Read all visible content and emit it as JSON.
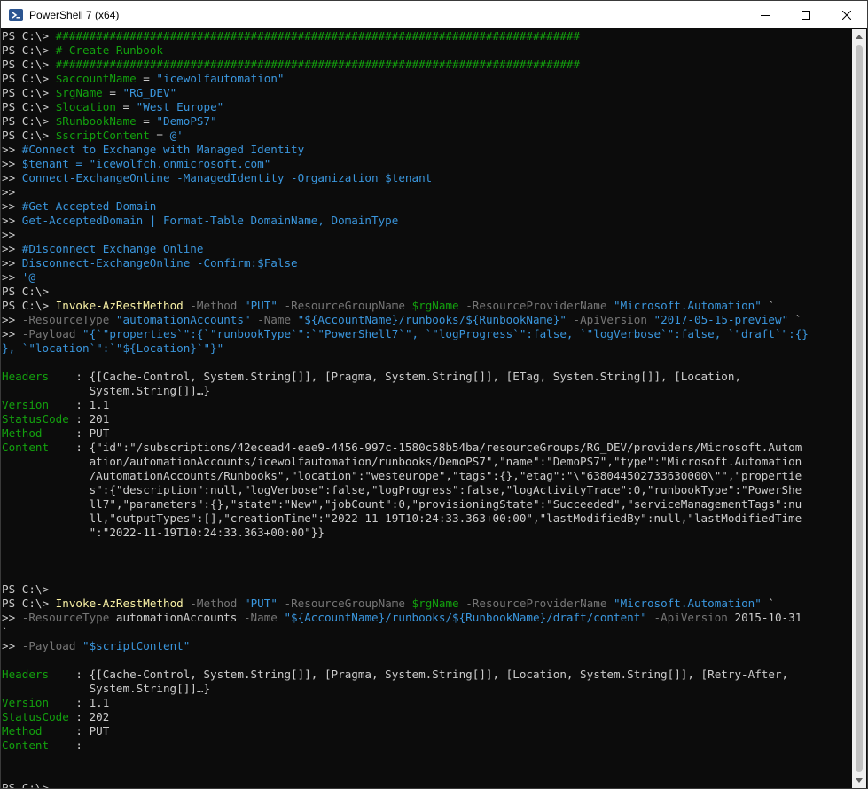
{
  "window": {
    "title": "PowerShell 7 (x64)"
  },
  "icons": {
    "app": "powershell-icon",
    "minimize": "minimize-icon",
    "maximize": "maximize-icon",
    "close": "close-icon"
  },
  "terminal": {
    "lines": [
      [
        [
          "p",
          "PS C:\\> "
        ],
        [
          "c",
          "##############################################################################"
        ]
      ],
      [
        [
          "p",
          "PS C:\\> "
        ],
        [
          "c",
          "# Create Runbook"
        ]
      ],
      [
        [
          "p",
          "PS C:\\> "
        ],
        [
          "c",
          "##############################################################################"
        ]
      ],
      [
        [
          "p",
          "PS C:\\> "
        ],
        [
          "v",
          "$accountName"
        ],
        [
          "t",
          " = "
        ],
        [
          "s",
          "\"icewolfautomation\""
        ]
      ],
      [
        [
          "p",
          "PS C:\\> "
        ],
        [
          "v",
          "$rgName"
        ],
        [
          "t",
          " = "
        ],
        [
          "s",
          "\"RG_DEV\""
        ]
      ],
      [
        [
          "p",
          "PS C:\\> "
        ],
        [
          "v",
          "$location"
        ],
        [
          "t",
          " = "
        ],
        [
          "s",
          "\"West Europe\""
        ]
      ],
      [
        [
          "p",
          "PS C:\\> "
        ],
        [
          "v",
          "$RunbookName"
        ],
        [
          "t",
          " = "
        ],
        [
          "s",
          "\"DemoPS7\""
        ]
      ],
      [
        [
          "p",
          "PS C:\\> "
        ],
        [
          "v",
          "$scriptContent"
        ],
        [
          "t",
          " = "
        ],
        [
          "s",
          "@'"
        ]
      ],
      [
        [
          "p",
          ">> "
        ],
        [
          "s",
          "#Connect to Exchange with Managed Identity"
        ]
      ],
      [
        [
          "p",
          ">> "
        ],
        [
          "s",
          "$tenant = \"icewolfch.onmicrosoft.com\""
        ]
      ],
      [
        [
          "p",
          ">> "
        ],
        [
          "s",
          "Connect-ExchangeOnline -ManagedIdentity -Organization $tenant"
        ]
      ],
      [
        [
          "p",
          ">>"
        ]
      ],
      [
        [
          "p",
          ">> "
        ],
        [
          "s",
          "#Get Accepted Domain"
        ]
      ],
      [
        [
          "p",
          ">> "
        ],
        [
          "s",
          "Get-AcceptedDomain | Format-Table DomainName, DomainType"
        ]
      ],
      [
        [
          "p",
          ">>"
        ]
      ],
      [
        [
          "p",
          ">> "
        ],
        [
          "s",
          "#Disconnect Exchange Online"
        ]
      ],
      [
        [
          "p",
          ">> "
        ],
        [
          "s",
          "Disconnect-ExchangeOnline -Confirm:$False"
        ]
      ],
      [
        [
          "p",
          ">> "
        ],
        [
          "s",
          "'@"
        ]
      ],
      [
        [
          "p",
          "PS C:\\>"
        ]
      ],
      [
        [
          "p",
          "PS C:\\> "
        ],
        [
          "k",
          "Invoke-AzRestMethod"
        ],
        [
          "m",
          " -Method "
        ],
        [
          "s",
          "\"PUT\""
        ],
        [
          "m",
          " -ResourceGroupName "
        ],
        [
          "v",
          "$rgName"
        ],
        [
          "m",
          " -ResourceProviderName "
        ],
        [
          "s",
          "\"Microsoft.Automation\""
        ],
        [
          "t",
          " `"
        ]
      ],
      [
        [
          "p",
          ">> "
        ],
        [
          "m",
          "-ResourceType "
        ],
        [
          "s",
          "\"automationAccounts\""
        ],
        [
          "m",
          " -Name "
        ],
        [
          "s",
          "\"${AccountName}/runbooks/${RunbookName}\""
        ],
        [
          "m",
          " -ApiVersion "
        ],
        [
          "s",
          "\"2017-05-15-preview\""
        ],
        [
          "t",
          " `"
        ]
      ],
      [
        [
          "p",
          ">> "
        ],
        [
          "m",
          "-Payload "
        ],
        [
          "s",
          "\"{`\"properties`\":{`\"runbookType`\":`\"PowerShell7`\", `\"logProgress`\":false, `\"logVerbose`\":false, `\"draft`\":{}"
        ]
      ],
      [
        [
          "s",
          "}, `\"location`\":`\"${Location}`\"}\""
        ]
      ],
      [
        [
          "t",
          ""
        ]
      ],
      [
        [
          "h",
          "Headers    "
        ],
        [
          "t",
          ": {[Cache-Control, System.String[]], [Pragma, System.String[]], [ETag, System.String[]], [Location,"
        ]
      ],
      [
        [
          "t",
          "             System.String[]]…}"
        ]
      ],
      [
        [
          "h",
          "Version    "
        ],
        [
          "t",
          ": 1.1"
        ]
      ],
      [
        [
          "h",
          "StatusCode "
        ],
        [
          "t",
          ": 201"
        ]
      ],
      [
        [
          "h",
          "Method     "
        ],
        [
          "t",
          ": PUT"
        ]
      ],
      [
        [
          "h",
          "Content    "
        ],
        [
          "t",
          ": {\"id\":\"/subscriptions/42ecead4-eae9-4456-997c-1580c58b54ba/resourceGroups/RG_DEV/providers/Microsoft.Autom"
        ]
      ],
      [
        [
          "t",
          "             ation/automationAccounts/icewolfautomation/runbooks/DemoPS7\",\"name\":\"DemoPS7\",\"type\":\"Microsoft.Automation"
        ]
      ],
      [
        [
          "t",
          "             /AutomationAccounts/Runbooks\",\"location\":\"westeurope\",\"tags\":{},\"etag\":\"\\\"638044502733630000\\\"\",\"propertie"
        ]
      ],
      [
        [
          "t",
          "             s\":{\"description\":null,\"logVerbose\":false,\"logProgress\":false,\"logActivityTrace\":0,\"runbookType\":\"PowerShe"
        ]
      ],
      [
        [
          "t",
          "             ll7\",\"parameters\":{},\"state\":\"New\",\"jobCount\":0,\"provisioningState\":\"Succeeded\",\"serviceManagementTags\":nu"
        ]
      ],
      [
        [
          "t",
          "             ll,\"outputTypes\":[],\"creationTime\":\"2022-11-19T10:24:33.363+00:00\",\"lastModifiedBy\":null,\"lastModifiedTime"
        ]
      ],
      [
        [
          "t",
          "             \":\"2022-11-19T10:24:33.363+00:00\"}}"
        ]
      ],
      [
        [
          "t",
          ""
        ]
      ],
      [
        [
          "t",
          ""
        ]
      ],
      [
        [
          "t",
          ""
        ]
      ],
      [
        [
          "p",
          "PS C:\\>"
        ]
      ],
      [
        [
          "p",
          "PS C:\\> "
        ],
        [
          "k",
          "Invoke-AzRestMethod"
        ],
        [
          "m",
          " -Method "
        ],
        [
          "s",
          "\"PUT\""
        ],
        [
          "m",
          " -ResourceGroupName "
        ],
        [
          "v",
          "$rgName"
        ],
        [
          "m",
          " -ResourceProviderName "
        ],
        [
          "s",
          "\"Microsoft.Automation\""
        ],
        [
          "t",
          " `"
        ]
      ],
      [
        [
          "p",
          ">> "
        ],
        [
          "m",
          "-ResourceType "
        ],
        [
          "t",
          "automationAccounts"
        ],
        [
          "m",
          " -Name "
        ],
        [
          "s",
          "\"${AccountName}/runbooks/${RunbookName}/draft/content\""
        ],
        [
          "m",
          " -ApiVersion "
        ],
        [
          "t",
          "2015-10-31"
        ]
      ],
      [
        [
          "t",
          "`"
        ]
      ],
      [
        [
          "p",
          ">> "
        ],
        [
          "m",
          "-Payload "
        ],
        [
          "s",
          "\"$scriptContent\""
        ]
      ],
      [
        [
          "t",
          ""
        ]
      ],
      [
        [
          "h",
          "Headers    "
        ],
        [
          "t",
          ": {[Cache-Control, System.String[]], [Pragma, System.String[]], [Location, System.String[]], [Retry-After,"
        ]
      ],
      [
        [
          "t",
          "             System.String[]]…}"
        ]
      ],
      [
        [
          "h",
          "Version    "
        ],
        [
          "t",
          ": 1.1"
        ]
      ],
      [
        [
          "h",
          "StatusCode "
        ],
        [
          "t",
          ": 202"
        ]
      ],
      [
        [
          "h",
          "Method     "
        ],
        [
          "t",
          ": PUT"
        ]
      ],
      [
        [
          "h",
          "Content    "
        ],
        [
          "t",
          ":"
        ]
      ],
      [
        [
          "t",
          ""
        ]
      ],
      [
        [
          "t",
          ""
        ]
      ],
      [
        [
          "p",
          "PS C:\\> "
        ]
      ]
    ]
  }
}
